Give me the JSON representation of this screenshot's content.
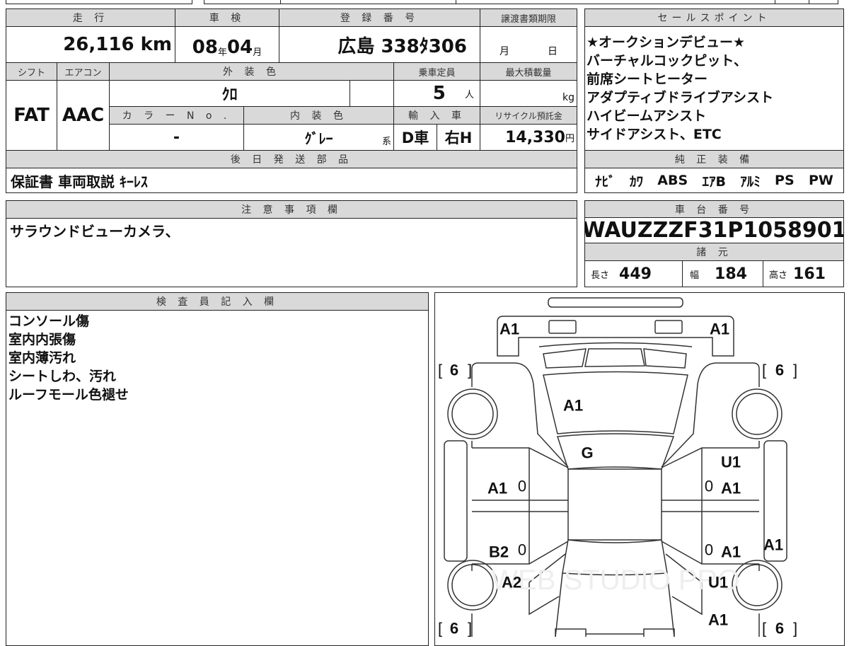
{
  "main_table": {
    "mileage_label": "走 行",
    "mileage_value": "26,116",
    "mileage_unit": "km",
    "inspection_label": "車 検",
    "inspection_year": "08",
    "year_unit": "年",
    "inspection_month": "04",
    "month_unit": "月",
    "registration_label": "登 録 番 号",
    "registration_value": "広島 338ﾀ306",
    "transfer_deadline_label": "譲渡書類期限",
    "transfer_month_unit": "月",
    "transfer_day_unit": "日",
    "shift_label": "シフト",
    "shift_value": "FAT",
    "aircon_label": "エアコン",
    "aircon_value": "AAC",
    "exterior_color_label": "外 装 色",
    "exterior_color_value": "ｸﾛ",
    "capacity_label": "乗車定員",
    "capacity_value": "5",
    "capacity_unit": "人",
    "max_load_label": "最大積載量",
    "max_load_unit": "kg",
    "color_no_label": "カ ラ ー N o .",
    "color_no_value": "-",
    "interior_color_label": "内 装 色",
    "interior_color_value": "ｸﾞﾚｰ",
    "interior_color_suffix": "系",
    "import_label": "輸 入 車",
    "import_dealer": "D車",
    "import_steering": "右H",
    "recycle_label": "リサイクル預託金",
    "recycle_value": "14,330",
    "recycle_unit": "円",
    "later_parts_label": "後 日 発 送 部 品",
    "later_parts_value": "保証書 車両取説 ｷｰﾚｽ"
  },
  "sales_points": {
    "label": "セールスポイント",
    "lines": [
      "★オークションデビュー★",
      "バーチャルコックピット、",
      "前席シートヒーター",
      "アダプティブドライブアシスト",
      "ハイビームアシスト",
      "サイドアシスト、ETC"
    ]
  },
  "equipment": {
    "label": "純 正 装 備",
    "items": [
      "ﾅﾋﾞ",
      "ｶﾜ",
      "ABS",
      "ｴｱB",
      "ｱﾙﾐ",
      "PS",
      "PW"
    ]
  },
  "notes": {
    "label": "注 意 事 項 欄",
    "value": "サラウンドビューカメラ、"
  },
  "chassis": {
    "label": "車 台 番 号",
    "value": "WAUZZZF31P1058901"
  },
  "specs": {
    "label": "諸 元",
    "length_label": "長さ",
    "length": "449",
    "width_label": "幅",
    "width": "184",
    "height_label": "高さ",
    "height": "161"
  },
  "inspector": {
    "label": "検 査 員 記 入 欄",
    "lines": [
      "コンソール傷",
      "室内内張傷",
      "室内薄汚れ",
      "シートしわ、汚れ",
      "ルーフモール色褪せ"
    ]
  },
  "diagram": {
    "marks": [
      "A1",
      "A1",
      "A1",
      "G",
      "U1",
      "A1",
      "A1",
      "B2",
      "A1",
      "A1",
      "A2",
      "U1",
      "A1"
    ],
    "tire": "6",
    "zero": "0",
    "watermark": "WEB STUDIO PRO"
  }
}
